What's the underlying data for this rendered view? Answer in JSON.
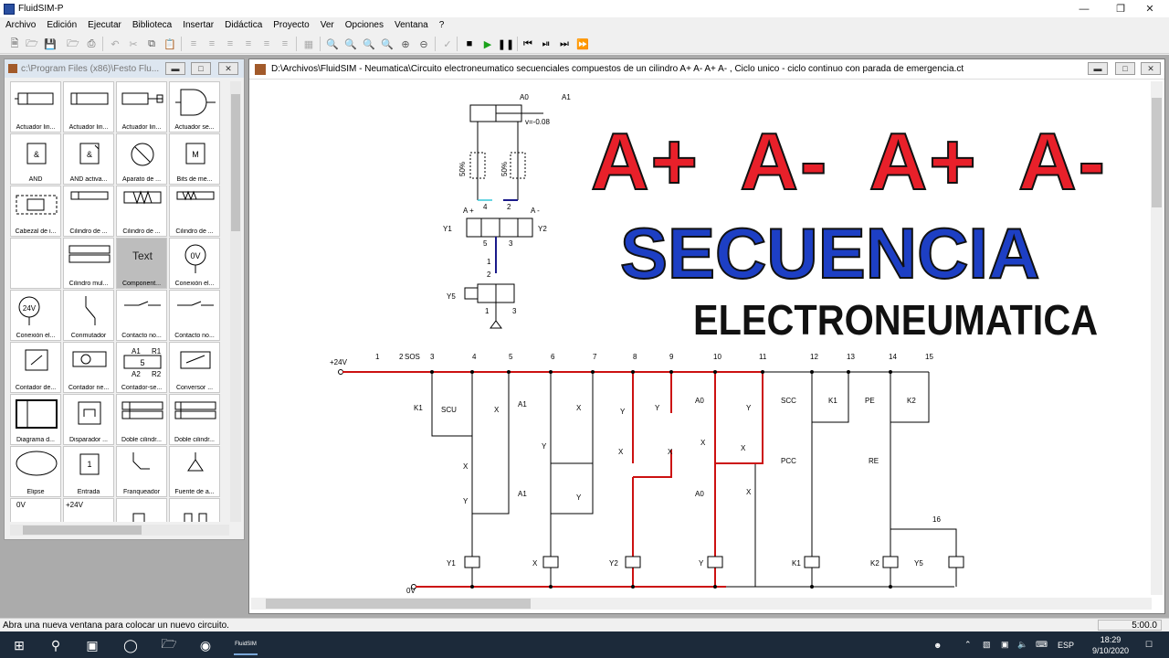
{
  "app": {
    "title": "FluidSIM-P",
    "menu": [
      "Archivo",
      "Edición",
      "Ejecutar",
      "Biblioteca",
      "Insertar",
      "Didáctica",
      "Proyecto",
      "Ver",
      "Opciones",
      "Ventana",
      "?"
    ]
  },
  "library": {
    "title": "c:\\Program Files (x86)\\Festo Flu...",
    "items": [
      "Actuador lin...",
      "Actuador lin...",
      "Actuador lin...",
      "Actuador se...",
      "AND",
      "AND activa...",
      "Aparato de ...",
      "Bits de me...",
      "Cabezal de i...",
      "Cilindro de ...",
      "Cilindro de ...",
      "Cilindro de ...",
      "",
      "Cilindro mul...",
      "Component...",
      "Conexión el...",
      "Conexión el...",
      "Conmutador",
      "Contacto no...",
      "Contacto no...",
      "Contador de...",
      "Contador ne...",
      "Contador-se...",
      "Conversor ...",
      "Diagrama d...",
      "Disparador ...",
      "Doble cilindr...",
      "Doble cilindr...",
      "Elipse",
      "Entrada",
      "Franqueador",
      "Fuente de a...",
      "",
      "",
      "",
      ""
    ],
    "text_item_glyph": "Text",
    "icon_texts": {
      "and": "&",
      "bits": "M",
      "conexion1": "0V",
      "conexion2": "24V",
      "contador_a1": "A1",
      "contador_r1": "R1",
      "contador_a2": "A2",
      "contador_r2": "R2",
      "contador_val": "5",
      "entrada": "1",
      "row_last_1": "0V",
      "row_last_2": "+24V"
    }
  },
  "circuit_window": {
    "title": "D:\\Archivos\\FluidSIM - Neumatica\\Circuito electroneumatico secuenciales compuestos de un cilindro A+ A- A+ A- , Ciclo unico - ciclo continuo con parada de emergencia.ct"
  },
  "headline": {
    "sequence": [
      "A+",
      "A-",
      "A+",
      "A-"
    ],
    "title": "SECUENCIA",
    "subtitle": "ELECTRONEUMATICA",
    "colors": {
      "red": "#e8202a",
      "blue": "#1d3fc4",
      "black": "#111111",
      "wire_red": "#cc1111"
    }
  },
  "pneumatic": {
    "cyl_a0": "A0",
    "cyl_a1": "A1",
    "cyl_a1b": "A1",
    "v_label": "v=-0.08",
    "pct1": "50%",
    "pct2": "50%",
    "aplus": "A +",
    "aminus": "A -",
    "y1": "Y1",
    "y2": "Y2",
    "y5": "Y5",
    "p4": "4",
    "p2": "2",
    "p5": "5",
    "p1": "1",
    "p3": "3",
    "p2b": "2",
    "p1b": "1",
    "p3b": "3"
  },
  "ladder": {
    "v24": "+24V",
    "v0": "0V",
    "sos": "SOS",
    "col_numbers": [
      "1",
      "2",
      "3",
      "4",
      "5",
      "6",
      "7",
      "8",
      "9",
      "10",
      "11",
      "12",
      "13",
      "14",
      "15"
    ],
    "n16": "16",
    "contacts": {
      "k1a": "K1",
      "scu": "SCU",
      "x1": "X",
      "a1a": "A1",
      "x2": "X",
      "x3": "X",
      "x4": "X",
      "a0a": "A0",
      "scc": "SCC",
      "k1b": "K1",
      "pe": "PE",
      "k2a": "K2",
      "x5": "X",
      "x6": "X",
      "x7": "X",
      "pcc": "PCC",
      "re": "RE",
      "y1c": "Y",
      "a1b": "A1",
      "y2c": "Y",
      "a0b": "A0",
      "x8": "X",
      "y3c": "Y",
      "y4c": "Y",
      "y5c": "Y",
      "y6c": "Y"
    },
    "coils": {
      "y1": "Y1",
      "x": "X",
      "y2": "Y2",
      "y": "Y",
      "k1": "K1",
      "k2": "K2",
      "y5": "Y5"
    }
  },
  "status": {
    "message": "Abra una nueva ventana para colocar un nuevo circuito.",
    "time": "5:00.0"
  },
  "taskbar": {
    "time": "18:29",
    "date": "9/10/2020",
    "lang": "ESP",
    "fluidsim_label": "FluidSIM"
  }
}
